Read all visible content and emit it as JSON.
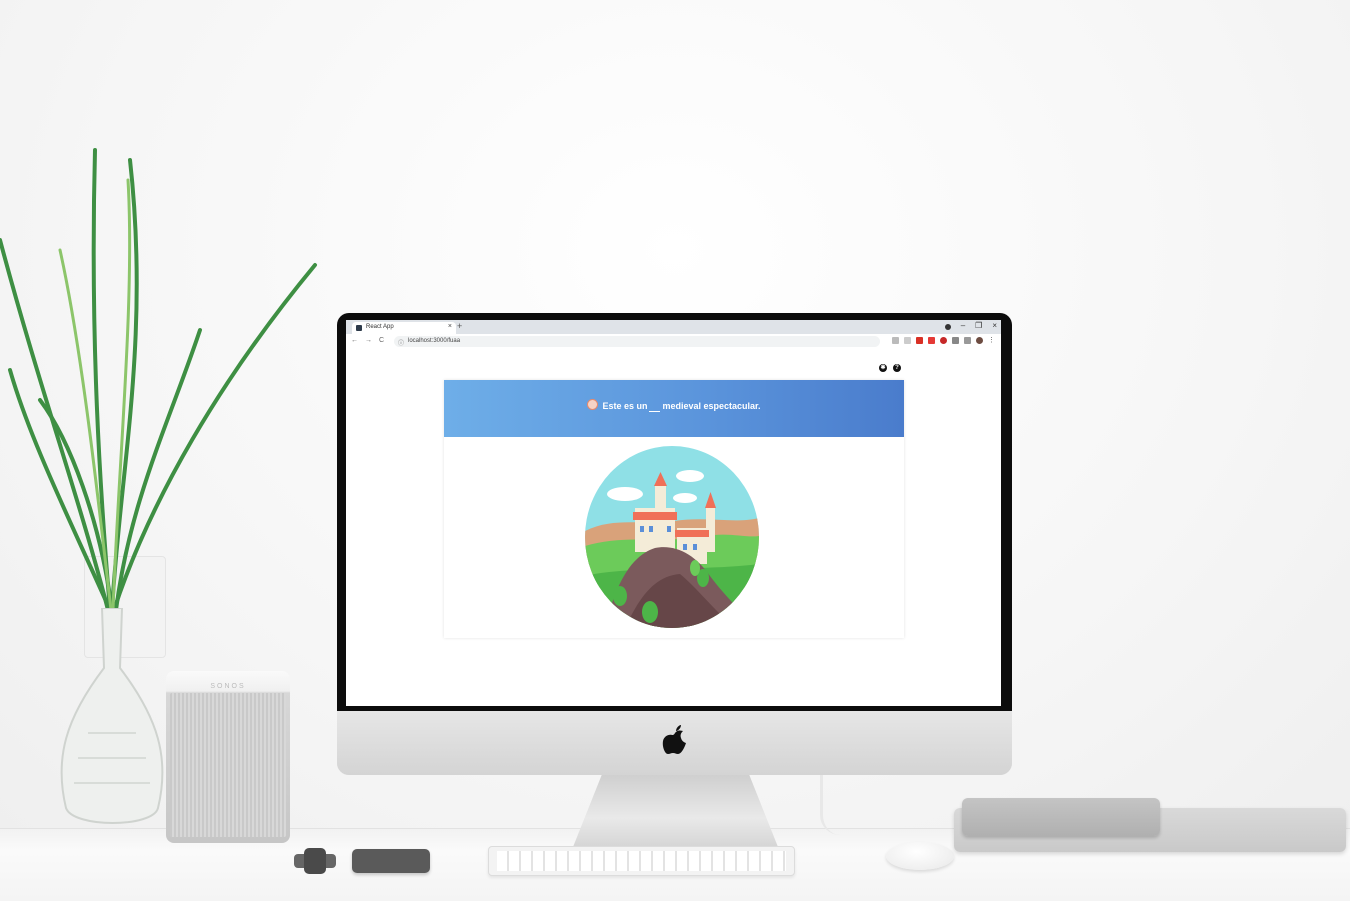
{
  "browser": {
    "tab_title": "React App",
    "new_tab_symbol": "+",
    "tab_close_symbol": "×",
    "url": "localhost:3000/fuaa",
    "window_controls": [
      "–",
      "❐",
      "×"
    ],
    "nav_symbols": [
      "←",
      "→",
      "C"
    ]
  },
  "page": {
    "top_icons": [
      "✱",
      "?"
    ],
    "sentence_before": "Este es un",
    "sentence_after": "medieval espectacular.",
    "illustration": "castle-on-cliff-illustration"
  },
  "speaker": {
    "brand": "SONOS"
  },
  "colors": {
    "banner_start": "#6eaee8",
    "banner_end": "#4a7ccc",
    "sky": "#8fe0e6",
    "grass": "#6ccb5a",
    "rock": "#7b5a5c",
    "roof": "#f07058"
  }
}
